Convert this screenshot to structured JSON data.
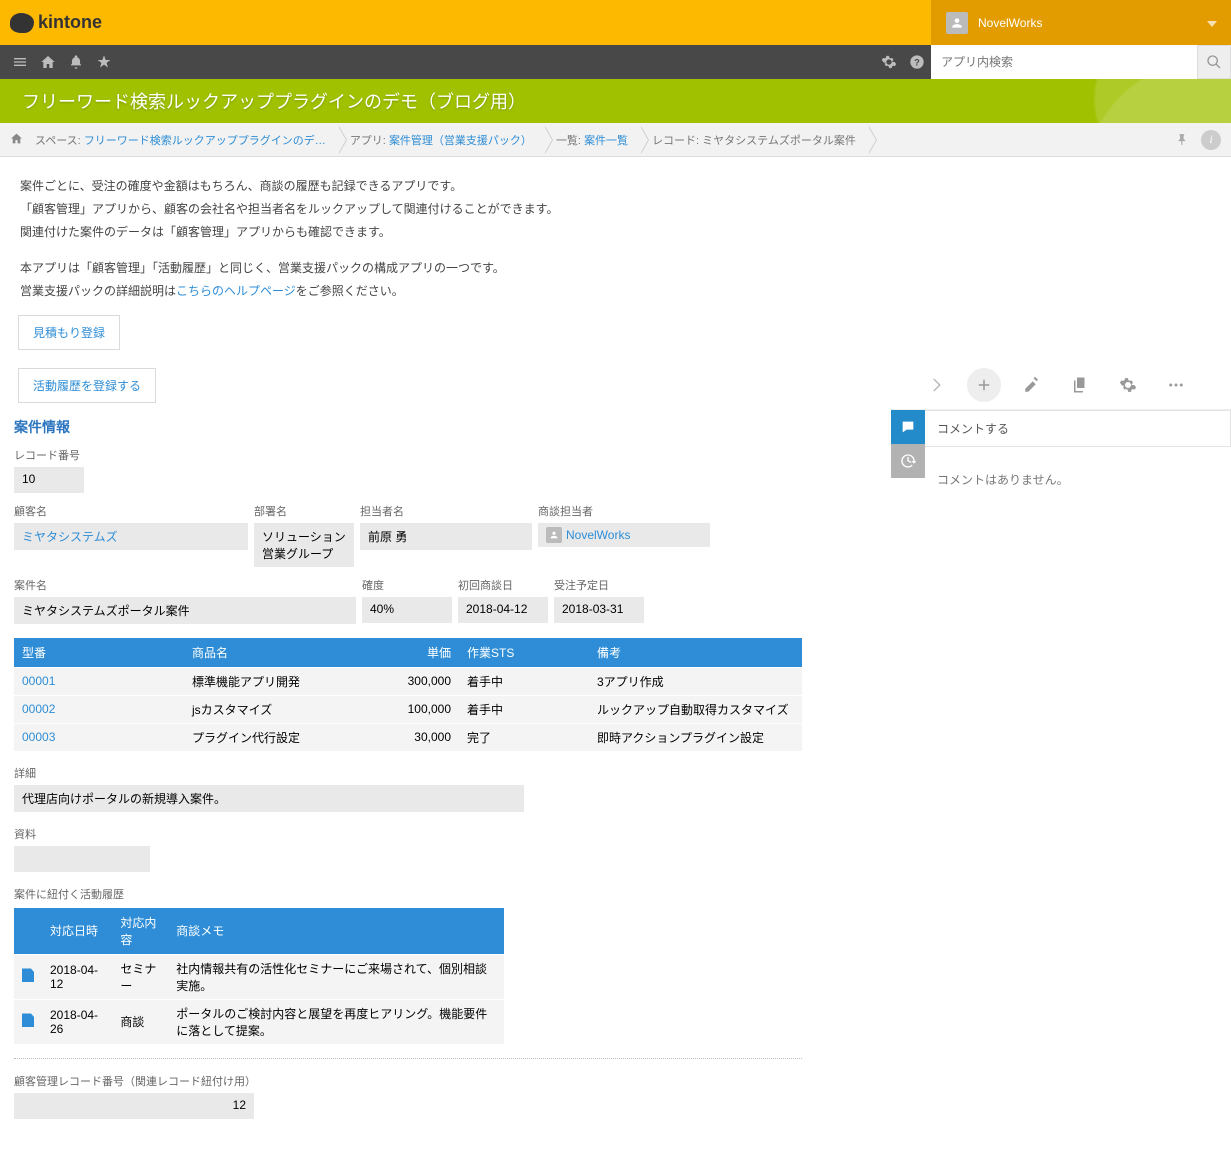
{
  "header": {
    "logo_text": "kintone",
    "user_name": "NovelWorks"
  },
  "search": {
    "placeholder": "アプリ内検索"
  },
  "app_title": "フリーワード検索ルックアッププラグインのデモ（ブログ用）",
  "breadcrumb": {
    "space_label": "スペース:",
    "space_link": "フリーワード検索ルックアッププラグインのデ…",
    "app_label": "アプリ:",
    "app_link": "案件管理（営業支援パック）",
    "list_label": "一覧:",
    "list_link": "案件一覧",
    "record_label": "レコード: ミヤタシステムズポータル案件"
  },
  "description": {
    "line1": "案件ごとに、受注の確度や金額はもちろん、商談の履歴も記録できるアプリです。",
    "line2": "「顧客管理」アプリから、顧客の会社名や担当者名をルックアップして関連付けることができます。",
    "line3": "関連付けた案件のデータは「顧客管理」アプリからも確認できます。",
    "line4_a": "本アプリは「顧客管理」「活動履歴」と同じく、営業支援パックの構成アプリの一つです。",
    "line5_a": "営業支援パックの詳細説明は",
    "line5_link": "こちらのヘルプページ",
    "line5_b": "をご参照ください。"
  },
  "buttons": {
    "quote_register": "見積もり登録",
    "activity_register": "活動履歴を登録する"
  },
  "section": {
    "case_info": "案件情報",
    "record_no_label": "レコード番号",
    "record_no": "10",
    "customer_label": "顧客名",
    "customer": "ミヤタシステムズ",
    "dept_label": "部署名",
    "dept": "ソリューション営業グループ",
    "contact_label": "担当者名",
    "contact": "前原 勇",
    "salesrep_label": "商談担当者",
    "salesrep": "NovelWorks",
    "case_name_label": "案件名",
    "case_name": "ミヤタシステムズポータル案件",
    "probability_label": "確度",
    "probability": "40%",
    "first_meet_label": "初回商談日",
    "first_meet": "2018-04-12",
    "expected_label": "受注予定日",
    "expected": "2018-03-31"
  },
  "products": {
    "headers": {
      "code": "型番",
      "name": "商品名",
      "price": "単価",
      "status": "作業STS",
      "notes": "備考"
    },
    "rows": [
      {
        "code": "00001",
        "name": "標準機能アプリ開発",
        "price": "300,000",
        "status": "着手中",
        "notes": "3アプリ作成"
      },
      {
        "code": "00002",
        "name": "jsカスタマイズ",
        "price": "100,000",
        "status": "着手中",
        "notes": "ルックアップ自動取得カスタマイズ"
      },
      {
        "code": "00003",
        "name": "プラグイン代行設定",
        "price": "30,000",
        "status": "完了",
        "notes": "即時アクションプラグイン設定"
      }
    ]
  },
  "detail": {
    "label": "詳細",
    "value": "代理店向けポータルの新規導入案件。"
  },
  "attachments": {
    "label": "資料"
  },
  "activities": {
    "label": "案件に紐付く活動履歴",
    "headers": {
      "date": "対応日時",
      "type": "対応内容",
      "memo": "商談メモ"
    },
    "rows": [
      {
        "date": "2018-04-12",
        "type": "セミナー",
        "memo": "社内情報共有の活性化セミナーにご来場されて、個別相談実施。"
      },
      {
        "date": "2018-04-26",
        "type": "商談",
        "memo": "ポータルのご検討内容と展望を再度ヒアリング。機能要件に落として提案。"
      }
    ]
  },
  "related": {
    "label": "顧客管理レコード番号（関連レコード紐付け用）",
    "value": "12"
  },
  "comments": {
    "title": "コメントする",
    "empty": "コメントはありません。"
  }
}
